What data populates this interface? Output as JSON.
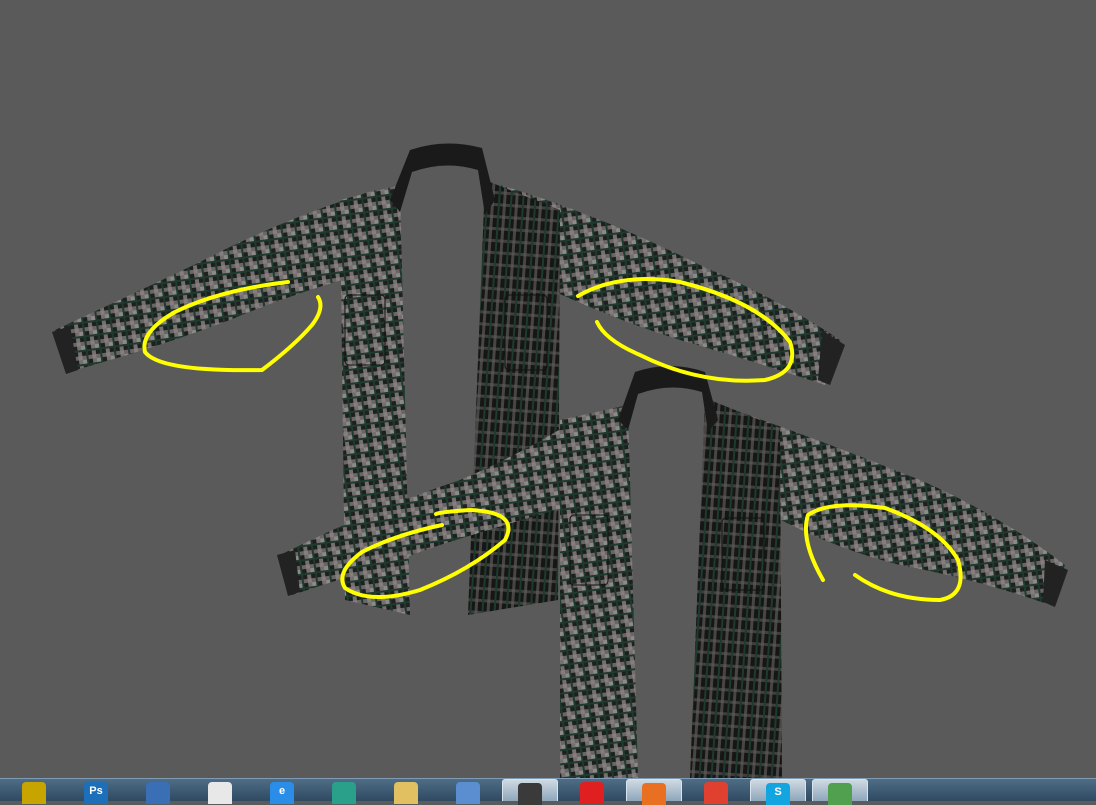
{
  "window": {
    "background": "#5a5a5a"
  },
  "annotation_color": "#ffff00",
  "taskbar": {
    "items": [
      {
        "icon": "maya-icon",
        "glyph": "",
        "color": "#c8a400",
        "active": false
      },
      {
        "icon": "photoshop-icon",
        "glyph": "Ps",
        "color": "#1c6fb8",
        "active": false
      },
      {
        "icon": "thunderbird-icon",
        "glyph": "",
        "color": "#3a6fb5",
        "active": false
      },
      {
        "icon": "runner-icon",
        "glyph": "",
        "color": "#e8e8e8",
        "active": false
      },
      {
        "icon": "internet-explorer-icon",
        "glyph": "e",
        "color": "#2a8ee8",
        "active": false
      },
      {
        "icon": "3dsmax-icon",
        "glyph": "",
        "color": "#2aa08a",
        "active": false
      },
      {
        "icon": "folder-icon",
        "glyph": "",
        "color": "#e0c060",
        "active": false
      },
      {
        "icon": "document-icon",
        "glyph": "",
        "color": "#5a8ed0",
        "active": false
      },
      {
        "icon": "3dsmax-active-icon",
        "glyph": "",
        "color": "#3a3a3a",
        "active": true
      },
      {
        "icon": "red-splat-icon",
        "glyph": "",
        "color": "#e02020",
        "active": false
      },
      {
        "icon": "firefox-icon",
        "glyph": "",
        "color": "#e87020",
        "active": true
      },
      {
        "icon": "chrome-icon",
        "glyph": "",
        "color": "#e04030",
        "active": false
      },
      {
        "icon": "skype-icon",
        "glyph": "S",
        "color": "#12a5e0",
        "active": true
      },
      {
        "icon": "messenger-icon",
        "glyph": "",
        "color": "#50a050",
        "active": true
      }
    ]
  }
}
